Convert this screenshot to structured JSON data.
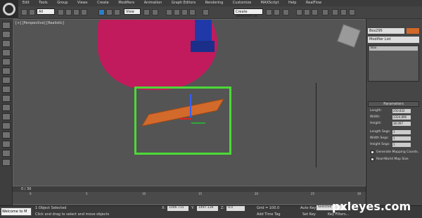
{
  "menu": [
    "Edit",
    "Tools",
    "Group",
    "Views",
    "Create",
    "Modifiers",
    "Animation",
    "Graph Editors",
    "Rendering",
    "Customize",
    "MAXScript",
    "Help",
    "RealFlow"
  ],
  "toolbar": {
    "selection_filter": "All",
    "ref_coord": "View",
    "named_sel": "Create Selection Se"
  },
  "viewport": {
    "label": "[+] [Perspective] [Realistic]"
  },
  "timeline": {
    "frame_label": "0 / 30",
    "ticks": [
      "0",
      "5",
      "10",
      "15",
      "20",
      "25",
      "30"
    ]
  },
  "status": {
    "welcome": "Welcome to M",
    "selected": "1 Object Selected",
    "prompt": "Click and drag to select and move objects",
    "x_label": "X:",
    "x_value": "1046.715",
    "y_label": "Y:",
    "y_value": "1497.136",
    "z_label": "Z:",
    "z_value": "0.0",
    "grid": "Grid = 100.0",
    "add_time_tag": "Add Time Tag",
    "auto_key": "Auto Key",
    "selected_dd": "Selected",
    "set_key": "Set Key",
    "key_filters": "Key Filters..."
  },
  "command_panel": {
    "object_name": "Box295",
    "modifier_list": "Modifier List",
    "stack_item": "Box",
    "params_title": "Parameters",
    "params": [
      {
        "label": "Length:",
        "value": "250.832"
      },
      {
        "label": "Width:",
        "value": "2324.896"
      },
      {
        "label": "Height:",
        "value": "36.097"
      },
      {
        "label": "Length Segs:",
        "value": "1"
      },
      {
        "label": "Width Segs:",
        "value": "1"
      },
      {
        "label": "Height Segs:",
        "value": "1"
      }
    ],
    "gen_mapping": "Generate Mapping Coords.",
    "real_world": "Real-World Map Size"
  },
  "watermark": "pxleyes.com",
  "colors": {
    "selection_box": "#4cd937",
    "board": "#d26a2b",
    "head": "#c21b5d"
  }
}
